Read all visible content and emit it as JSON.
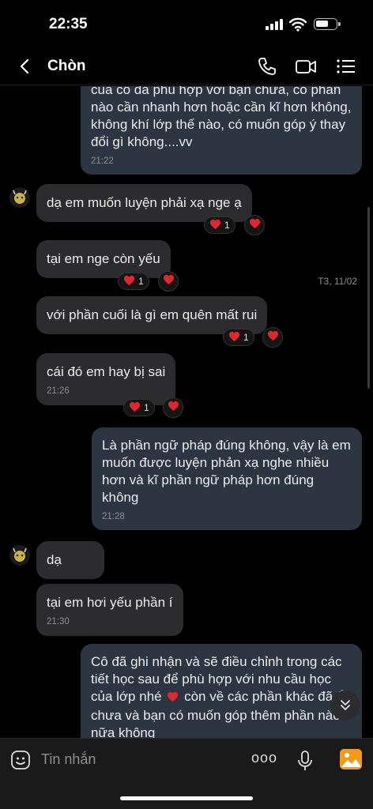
{
  "status_bar": {
    "time": "22:35"
  },
  "header": {
    "contact_name": "Chòn"
  },
  "messages": [
    {
      "text": "của cô đã phù hợp với bạn chưa, có phần nào cần nhanh hơn hoặc cần kĩ hơn không, không khí lớp thế nào, có muốn góp ý thay đổi gì không....vv",
      "time": "21:22"
    },
    {
      "text": "dạ em muốn luyện phải xạ nge ạ",
      "reaction_count": "1"
    },
    {
      "text": "tại em nge còn yếu",
      "reaction_count": "1"
    },
    {
      "text": "với phần cuối là gì em quên mất rui",
      "reaction_count": "1"
    },
    {
      "text": "cái đó em hay bị sai",
      "time": "21:26",
      "reaction_count": "1"
    },
    {
      "text": "Là phần ngữ pháp đúng không, vậy là em muốn được luyện phản xạ nghe nhiều hơn và kĩ phần ngữ pháp hơn đúng không",
      "time": "21:28"
    },
    {
      "text": "dạ"
    },
    {
      "text": "tại em hơi yếu phần í",
      "time": "21:30"
    },
    {
      "text_before_heart": "Cô đã ghi nhận và sẽ điều chỉnh trong các tiết học sau để phù hợp với nhu cầu học của lớp nhé",
      "text_after_heart": "còn về các phần khác đã ổn chưa và bạn có muốn góp thêm phần nào nữa không"
    }
  ],
  "date_separator": "T3, 11/02",
  "input": {
    "placeholder": "Tin nhắn",
    "more_label": "ooo"
  },
  "colors": {
    "heart": "#e0262e",
    "outgoing_bubble": "#2d3442",
    "incoming_bubble": "#2c2c2e"
  }
}
